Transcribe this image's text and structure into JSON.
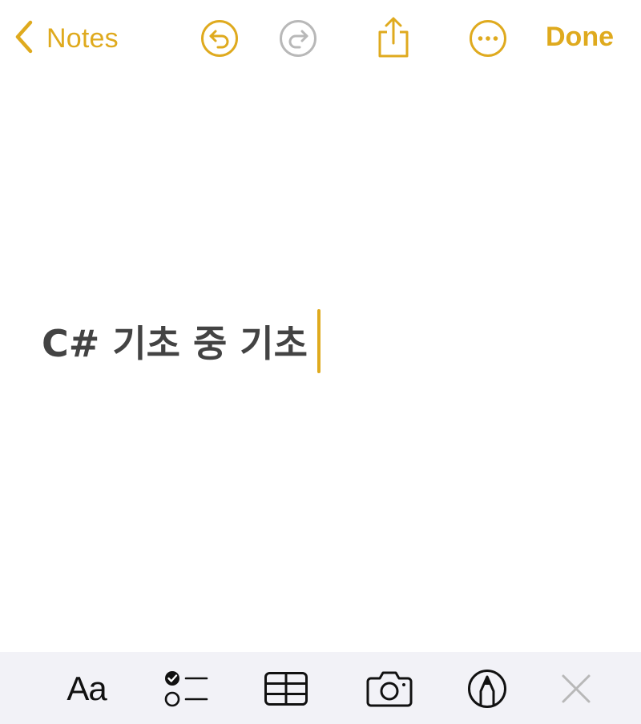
{
  "navbar": {
    "back_label": "Notes",
    "undo_icon": "undo-icon",
    "redo_icon": "redo-icon",
    "share_icon": "share-icon",
    "more_icon": "ellipsis-circle-icon",
    "done_label": "Done",
    "accent_color": "#DFAA1E",
    "disabled_color": "#B8B8B8"
  },
  "note": {
    "text": "C# 기초 중 기초",
    "text_color": "#434343",
    "cursor_color": "#DFAA1E"
  },
  "toolbar": {
    "format_label": "Aa",
    "checklist_icon": "checklist-icon",
    "table_icon": "table-icon",
    "camera_icon": "camera-icon",
    "markup_icon": "markup-pen-icon",
    "close_icon": "close-icon",
    "background_color": "#F2F2F7"
  }
}
